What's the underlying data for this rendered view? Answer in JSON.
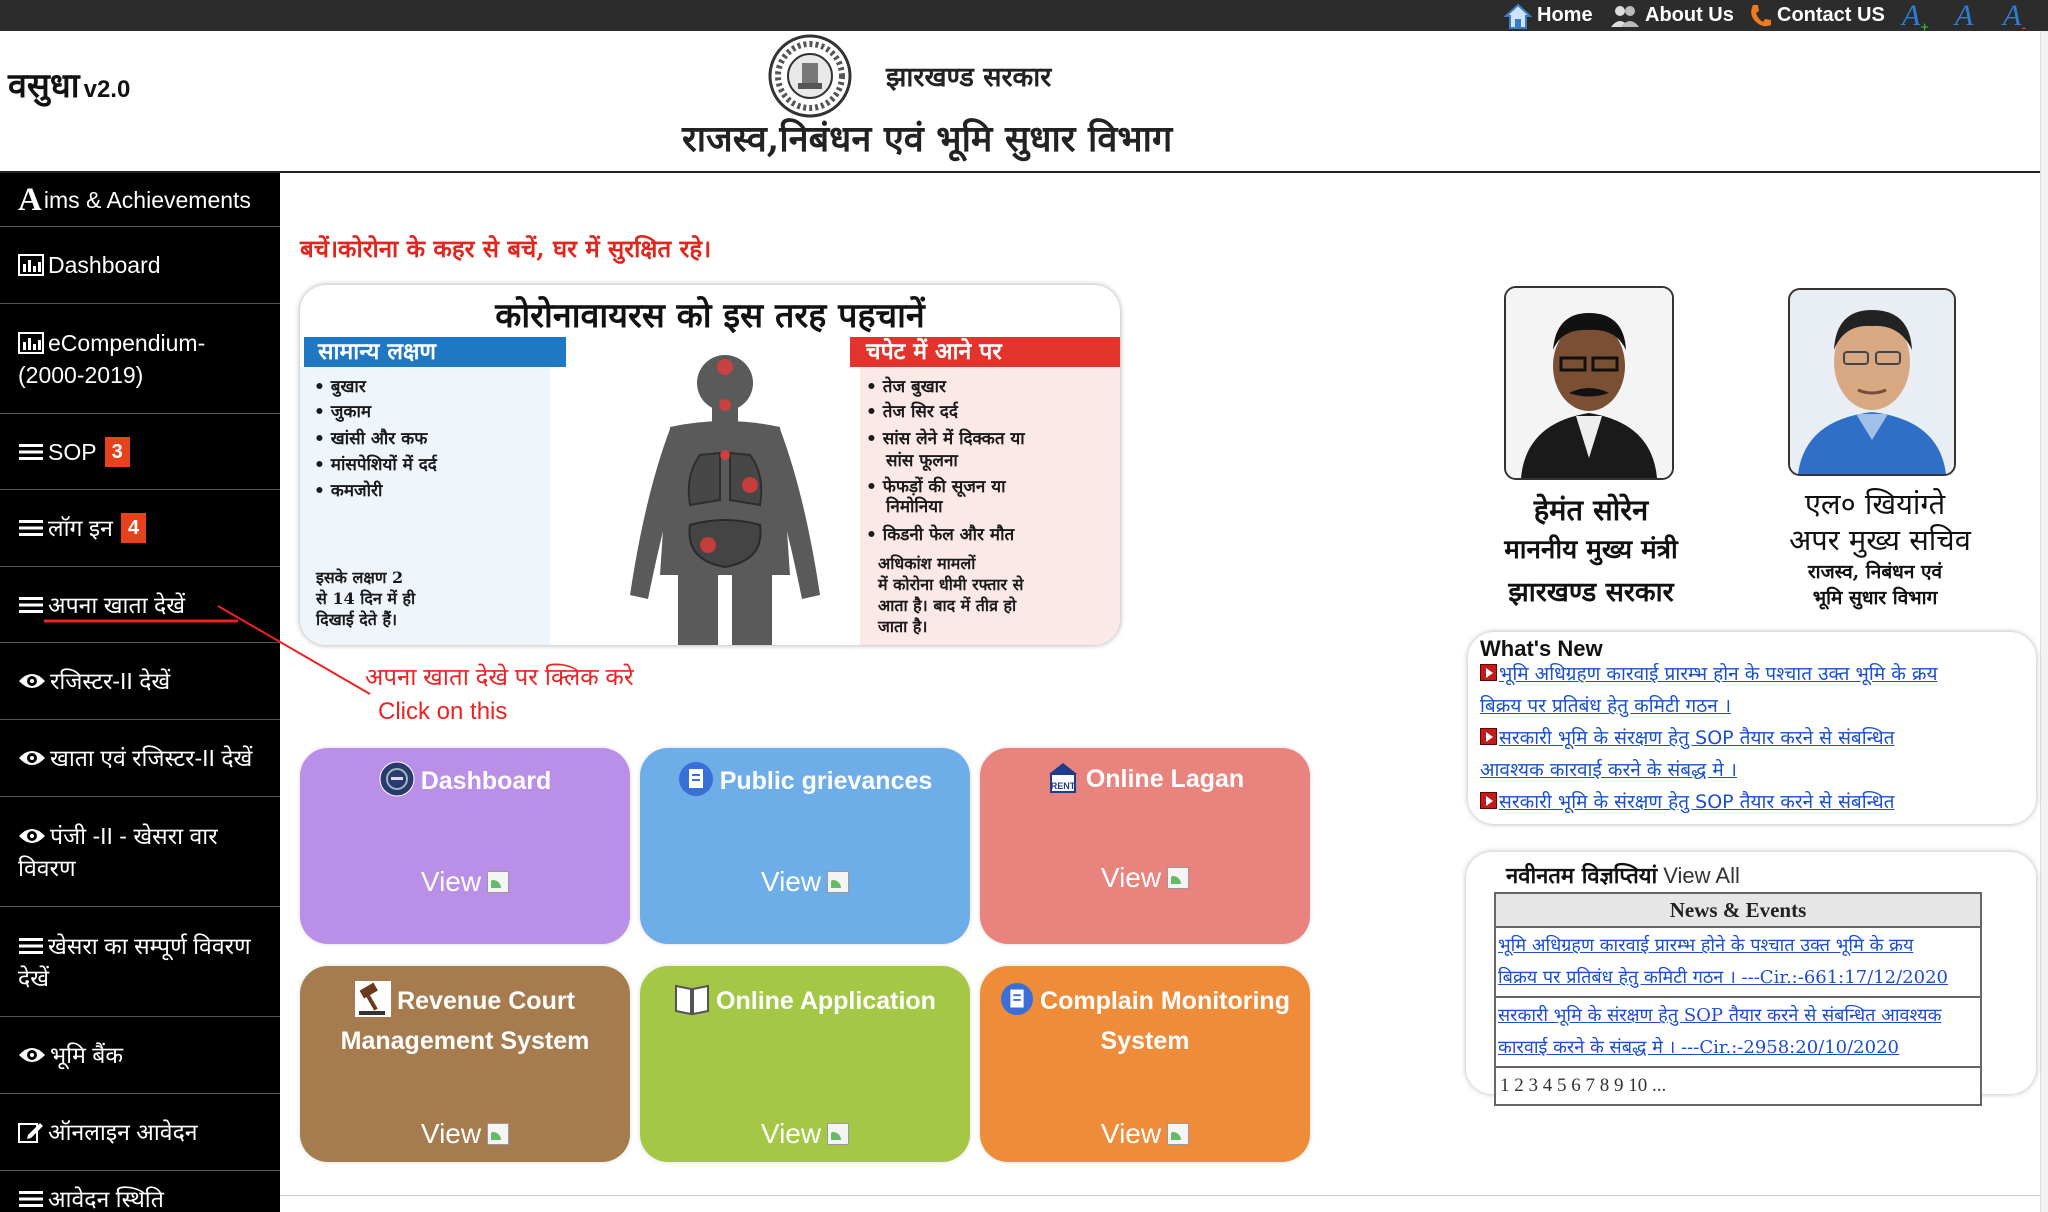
{
  "topbar": {
    "links": [
      "Home",
      "About Us",
      "Contact US"
    ],
    "font_controls": [
      "A+",
      "A",
      "A-"
    ]
  },
  "header": {
    "brand": "वसुधा",
    "version": "v2.0",
    "government": "झारखण्ड सरकार",
    "department": "राजस्व,निबंधन एवं भूमि सुधार विभाग"
  },
  "sidebar": {
    "items": [
      {
        "icon": "letter-a-icon",
        "first": "A",
        "label": "ims & Achievements"
      },
      {
        "icon": "bar-chart-icon",
        "label": "Dashboard"
      },
      {
        "icon": "bar-chart-icon",
        "label": "eCompendium-",
        "label2": "(2000-2019)"
      },
      {
        "icon": "list-icon",
        "label": "SOP",
        "badge": "3"
      },
      {
        "icon": "list-icon",
        "label": "लॉग इन",
        "badge": "4"
      },
      {
        "icon": "list-icon",
        "label": "अपना खाता देखें"
      },
      {
        "icon": "eye-icon",
        "label": "रजिस्टर-II देखें"
      },
      {
        "icon": "eye-icon",
        "label": "खाता एवं रजिस्टर-II देखें"
      },
      {
        "icon": "eye-icon",
        "label": "पंजी -II - खेसरा वार",
        "label2": "विवरण"
      },
      {
        "icon": "list-icon",
        "label": "खेसरा का सम्पूर्ण विवरण",
        "label2": "देखें"
      },
      {
        "icon": "eye-icon",
        "label": "भूमि बैंक"
      },
      {
        "icon": "edit-icon",
        "label": "ऑनलाइन आवेदन"
      },
      {
        "icon": "list-icon",
        "label": "आवेदन स्थिति"
      }
    ]
  },
  "main": {
    "alert": "बचें।कोरोना के कहर से बचें, घर में सुरक्षित रहे।",
    "poster": {
      "title": "कोरोनावायरस को इस तरह पहचानें",
      "left_header": "सामान्य लक्षण",
      "right_header": "चपेट में आने पर",
      "left_symptoms": [
        "बुखार",
        "जुकाम",
        "खांसी और कफ",
        "मांसपेशियों में दर्द",
        "कमजोरी"
      ],
      "right_symptoms": [
        "तेज बुखार",
        "तेज सिर दर्द",
        "सांस लेने में दिक्कत या",
        "सांस फूलना",
        "फेफड़ों की सूजन या",
        "निमोनिया",
        "किडनी फेल और मौत"
      ],
      "left_note": [
        "इसके लक्षण 2",
        "से 14 दिन में ही",
        "दिखाई देते हैं।"
      ],
      "right_note": [
        "अधिकांश मामलों",
        "में कोरोना धीमी रफ्तार से",
        "आता है। बाद में तीव्र हो",
        "जाता है।"
      ]
    },
    "annotation": {
      "hindi": "अपना खाता देखे पर  क्लिक करे",
      "english": "Click on this"
    },
    "tiles": [
      {
        "title": "Dashboard",
        "view": "View",
        "color": "#b98fe8"
      },
      {
        "title": "Public grievances",
        "view": "View",
        "color": "#6eaee8"
      },
      {
        "title": "Online Lagan",
        "view": "View",
        "color": "#e8847d",
        "icon_text": "RENT"
      },
      {
        "title": "Revenue Court",
        "title2": "Management System",
        "view": "View",
        "color": "#a67c4e"
      },
      {
        "title": "Online Application",
        "view": "View",
        "color": "#a4c746"
      },
      {
        "title": "Complain Monitoring",
        "title2": "System",
        "view": "View",
        "color": "#ef8c3a"
      }
    ]
  },
  "officials": [
    {
      "name": "हेमंत सोरेन",
      "title": "माननीय मुख्य मंत्री",
      "org": "झारखण्ड सरकार"
    },
    {
      "name": "एल० खियांग्ते",
      "title": "अपर मुख्य सचिव",
      "org": "राजस्व, निबंधन एवं",
      "org2": "भूमि सुधार विभाग"
    }
  ],
  "whats_new": {
    "heading": "What's New",
    "lines": [
      "भूमि अधिग्रहण कारवाई प्रारम्भ होन के पश्चात उक्त भूमि के क्रय",
      "बिक्रय पर प्रतिबंध हेतु कमिटी गठन ।",
      "सरकारी भूमि के संरक्षण हेतु SOP तैयार करने से संबन्धित",
      "आवश्यक कारवाई करने के संबद्ध मे ।",
      "सरकारी भूमि के संरक्षण हेतु SOP तैयार करने से संबन्धित"
    ]
  },
  "notices": {
    "heading": "नवीनतम विज्ञप्तियां",
    "view_all": "View All",
    "table_header": "News & Events",
    "rows": [
      [
        "भूमि अधिग्रहण कारवाई प्रारम्भ होने के पश्चात उक्त भूमि के क्रय",
        "बिक्रय पर प्रतिबंध हेतु कमिटी गठन । ---Cir.:-661:17/12/2020"
      ],
      [
        "सरकारी भूमि के संरक्षण हेतु SOP तैयार करने से संबन्धित आवश्यक",
        "कारवाई करने के संबद्ध मे । ---Cir.:-2958:20/10/2020"
      ]
    ],
    "pages": "1 2 3 4 5 6 7 8 9 10 ..."
  }
}
